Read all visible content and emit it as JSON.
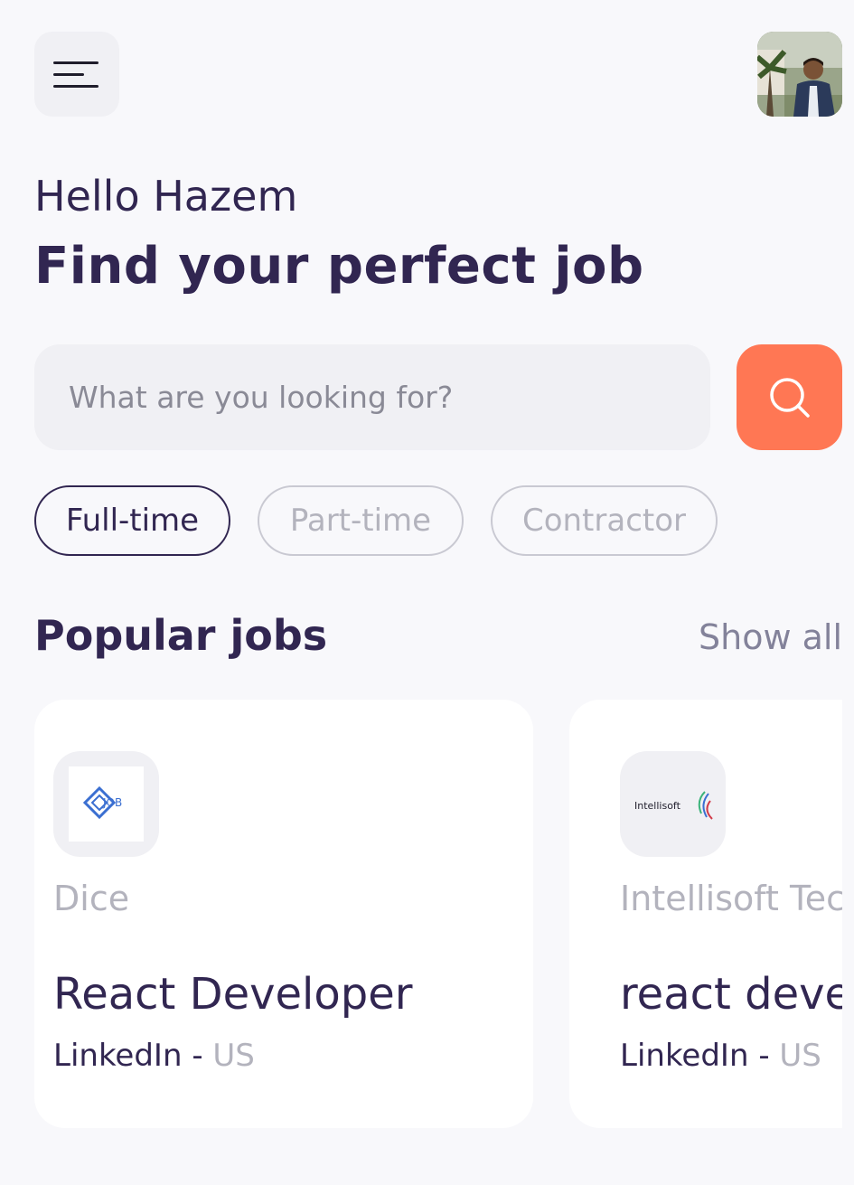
{
  "header": {
    "menu_icon": "hamburger-menu-icon",
    "avatar": "profile-photo"
  },
  "welcome": {
    "greeting": "Hello Hazem",
    "headline": "Find your perfect job"
  },
  "search": {
    "placeholder": "What are you looking for?",
    "value": "",
    "button_icon": "search-icon"
  },
  "job_types": {
    "items": [
      {
        "label": "Full-time",
        "active": true
      },
      {
        "label": "Part-time",
        "active": false
      },
      {
        "label": "Contractor",
        "active": false
      }
    ]
  },
  "popular": {
    "title": "Popular jobs",
    "show_all": "Show all",
    "jobs": [
      {
        "company": "Dice",
        "title": "React Developer",
        "publisher": "LinkedIn",
        "separator": "-",
        "location": "US",
        "logo_text": "JOB"
      },
      {
        "company": "Intellisoft Tec",
        "title": "react deve",
        "publisher": "LinkedIn",
        "separator": "-",
        "location": "US",
        "logo_text": "Intellisoft"
      }
    ]
  },
  "colors": {
    "primary": "#312651",
    "accent": "#ff7754",
    "muted": "#b3b3bd",
    "background": "#f8f8fb"
  }
}
